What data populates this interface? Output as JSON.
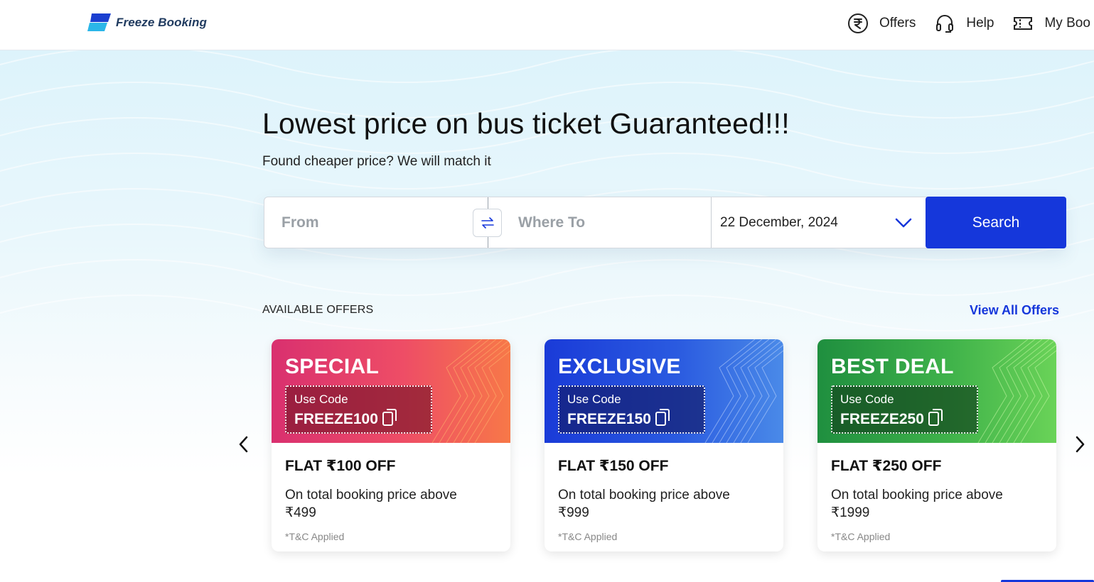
{
  "brand": {
    "name": "Freeze Booking"
  },
  "nav": {
    "items": [
      {
        "label": "Offers",
        "icon": "rupee-circle-icon"
      },
      {
        "label": "Help",
        "icon": "headset-icon"
      },
      {
        "label": "My Boo",
        "icon": "ticket-icon"
      }
    ]
  },
  "hero": {
    "title": "Lowest price on bus ticket Guaranteed!!!",
    "subtitle": "Found cheaper price? We will match it"
  },
  "search": {
    "from_placeholder": "From",
    "from_value": "",
    "to_placeholder": "Where To",
    "to_value": "",
    "date": "22 December, 2024",
    "button_label": "Search"
  },
  "offers": {
    "section_label": "AVAILABLE OFFERS",
    "view_all": "View All Offers",
    "cards": [
      {
        "tag": "SPECIAL",
        "code_label": "Use Code",
        "code": "FREEZE100",
        "title": "FLAT ₹100 OFF",
        "desc": "On total booking price above ₹499",
        "tc": "*T&C Applied",
        "color_start": "#d9306f",
        "color_end": "#f5734a"
      },
      {
        "tag": "EXCLUSIVE",
        "code_label": "Use Code",
        "code": "FREEZE150",
        "title": "FLAT ₹150 OFF",
        "desc": "On total booking price above ₹999",
        "tc": "*T&C Applied",
        "color_start": "#1a3bd8",
        "color_end": "#3f7fe6"
      },
      {
        "tag": "BEST DEAL",
        "code_label": "Use Code",
        "code": "FREEZE250",
        "title": "FLAT ₹250 OFF",
        "desc": "On total booking price above ₹1999",
        "tc": "*T&C Applied",
        "color_start": "#1f8f3f",
        "color_end": "#62cf52"
      }
    ]
  },
  "colors": {
    "primary": "#1537db",
    "hero_bg": "#ddf3fb"
  }
}
